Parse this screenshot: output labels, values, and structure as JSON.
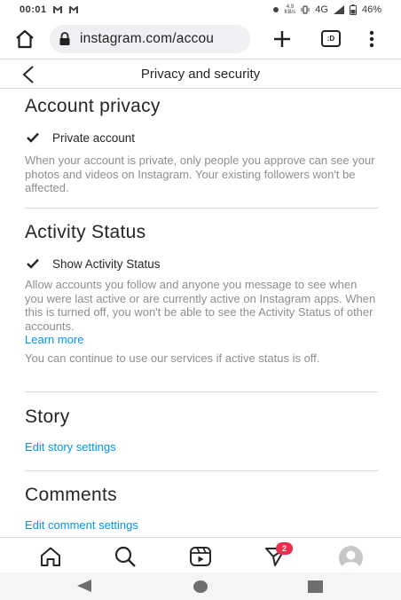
{
  "status_bar": {
    "time": "00:01",
    "left_icons": [
      "gmail-icon",
      "gmail-icon"
    ],
    "speed_value": "4.9",
    "speed_unit": "KB/s",
    "network": "4G",
    "battery": "46%"
  },
  "browser": {
    "url": "instagram.com/accou",
    "tab_label": ":D"
  },
  "header": {
    "title": "Privacy and security"
  },
  "account_privacy": {
    "title": "Account privacy",
    "checkbox_label": "Private account",
    "checked": true,
    "description": "When your account is private, only people you approve can see your photos and videos on Instagram. Your existing followers won't be affected."
  },
  "activity_status": {
    "title": "Activity Status",
    "checkbox_label": "Show Activity Status",
    "checked": true,
    "description": "Allow accounts you follow and anyone you message to see when you were last active or are currently active on Instagram apps. When this is turned off, you won't be able to see the Activity Status of other accounts.",
    "learn_more": "Learn more",
    "extra": "You can continue to use our services if active status is off."
  },
  "story": {
    "title": "Story",
    "link": "Edit story settings"
  },
  "comments": {
    "title": "Comments",
    "link": "Edit comment settings"
  },
  "bottom_nav": {
    "items": [
      "home-icon",
      "search-icon",
      "reels-icon",
      "direct-message-icon",
      "profile-avatar"
    ],
    "badge_count": "2",
    "accent": "#ed2e4b"
  },
  "colors": {
    "link": "#0095f6",
    "secondary_text": "#8e8e8e",
    "divider": "#dbdbdb"
  }
}
